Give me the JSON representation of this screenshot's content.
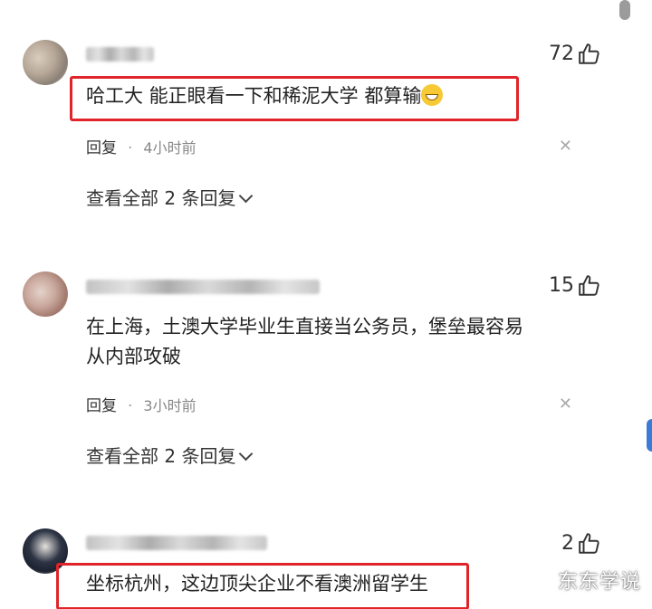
{
  "comments": [
    {
      "likes": "72",
      "text": "哈工大 能正眼看一下和稀泥大学 都算输",
      "reply_label": "回复",
      "time": "4小时前",
      "view_replies": "查看全部 2 条回复"
    },
    {
      "likes": "15",
      "text_line1": "在上海，土澳大学毕业生直接当公务员，堡垒最容易",
      "text_line2": "从内部攻破",
      "reply_label": "回复",
      "time": "3小时前",
      "view_replies": "查看全部 2 条回复"
    },
    {
      "likes": "2",
      "text": "坐标杭州，这边顶尖企业不看澳洲留学生"
    }
  ],
  "watermark": "东东学说",
  "colors": {
    "highlight_border": "#e0242a",
    "text": "#222222",
    "meta": "#888888"
  },
  "icons": [
    "thumbs-up-icon",
    "close-icon",
    "chevron-down-icon",
    "grin-emoji-icon"
  ]
}
